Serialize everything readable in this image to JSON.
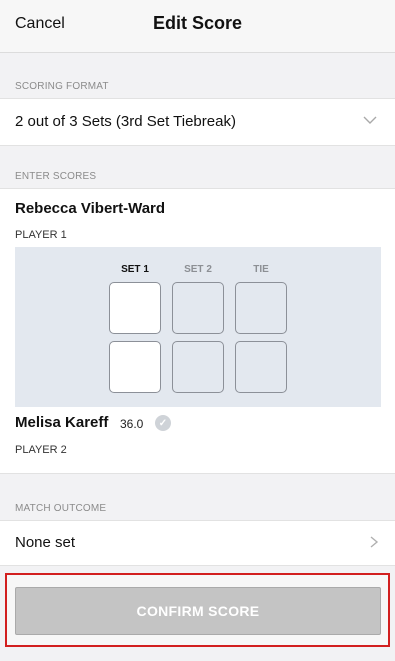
{
  "header": {
    "cancel_label": "Cancel",
    "title": "Edit Score"
  },
  "scoring_format": {
    "section_label": "SCORING FORMAT",
    "value": "2 out of 3 Sets (3rd Set Tiebreak)"
  },
  "enter_scores": {
    "section_label": "ENTER SCORES"
  },
  "player1": {
    "name": "Rebecca Vibert-Ward",
    "label": "PLAYER 1"
  },
  "player2": {
    "name": "Melisa Kareff",
    "rating": "36.0",
    "label": "PLAYER 2"
  },
  "score_grid": {
    "columns": [
      "SET 1",
      "SET 2",
      "TIE"
    ]
  },
  "match_outcome": {
    "section_label": "MATCH OUTCOME",
    "value": "None set"
  },
  "confirm": {
    "label": "CONFIRM SCORE"
  },
  "colors": {
    "highlight_border": "#d21f1f",
    "button_disabled": "#c4c4c4",
    "grid_bg": "#e3e8ef"
  },
  "icons": [
    "chevron-down-icon",
    "chevron-right-icon",
    "verified-badge-icon"
  ]
}
